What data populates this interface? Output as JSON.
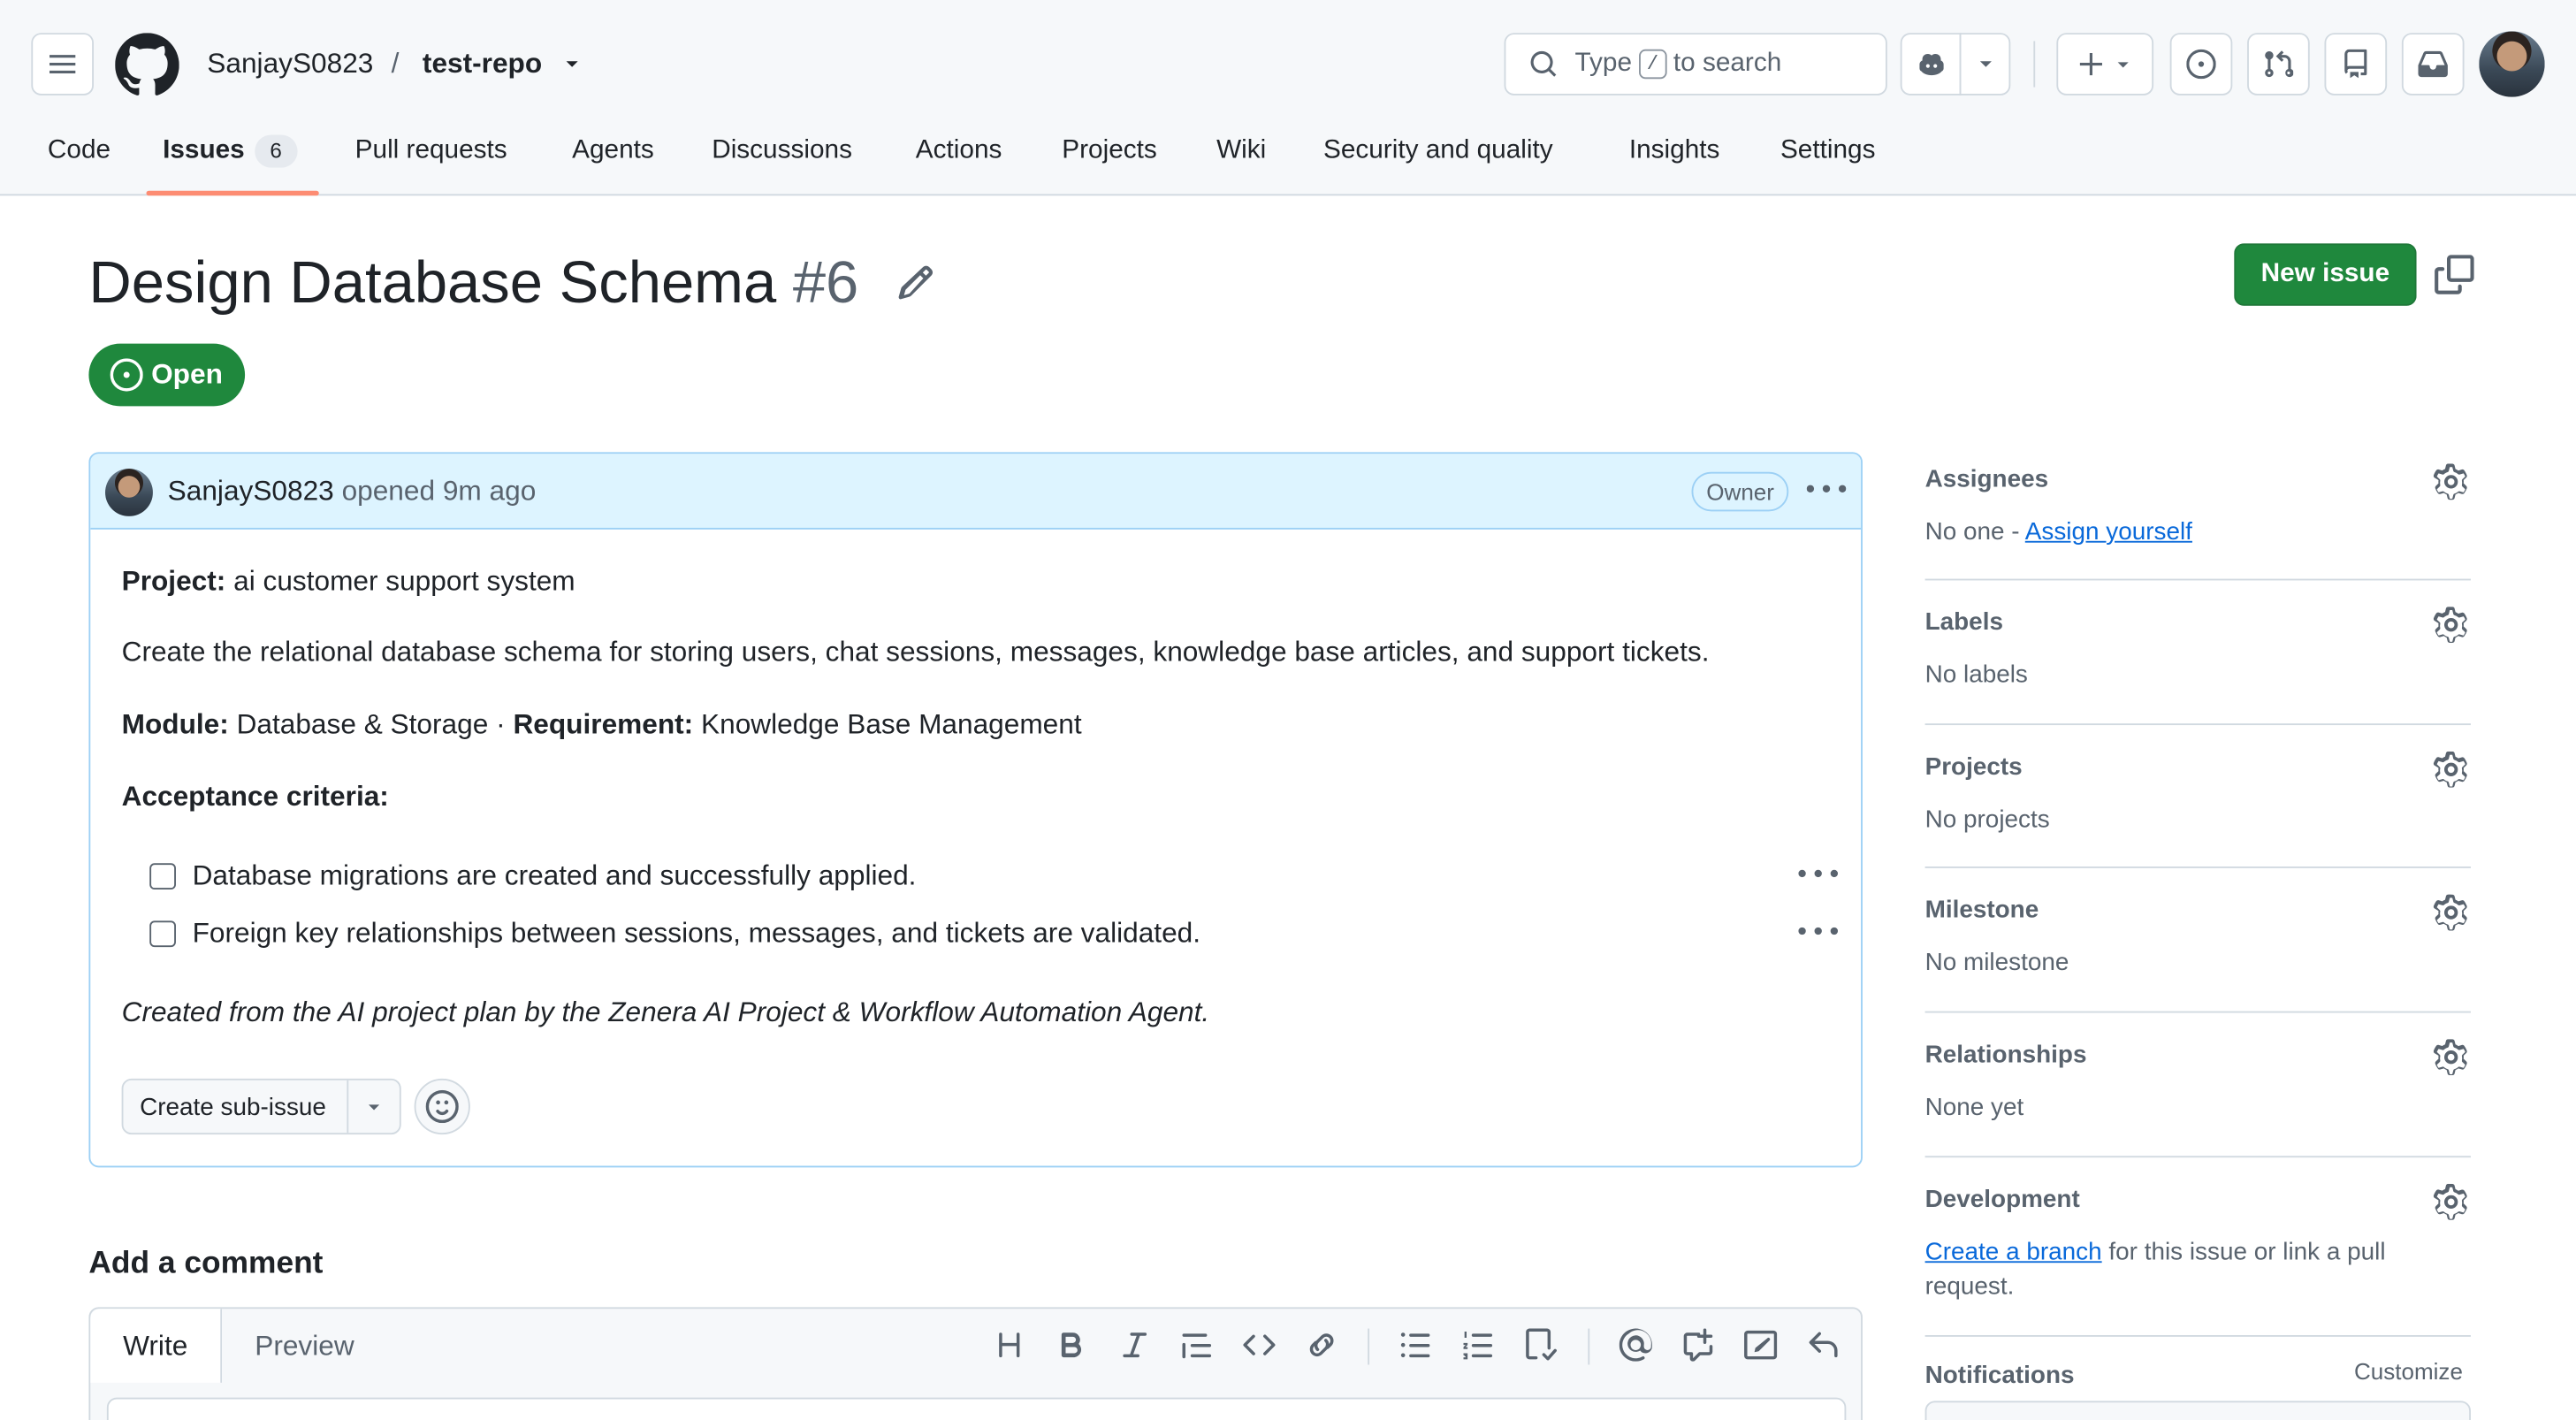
{
  "header": {
    "owner": "SanjayS0823",
    "separator": "/",
    "repo": "test-repo",
    "search_prefix": "Type",
    "search_key": "/",
    "search_suffix": "to search"
  },
  "tabs": [
    {
      "label": "Code"
    },
    {
      "label": "Issues",
      "count": "6"
    },
    {
      "label": "Pull requests"
    },
    {
      "label": "Agents"
    },
    {
      "label": "Discussions"
    },
    {
      "label": "Actions"
    },
    {
      "label": "Projects"
    },
    {
      "label": "Wiki"
    },
    {
      "label": "Security and quality"
    },
    {
      "label": "Insights"
    },
    {
      "label": "Settings"
    }
  ],
  "issue": {
    "title": "Design Database Schema",
    "number": "#6",
    "state": "Open",
    "new_issue_label": "New issue"
  },
  "comment": {
    "author": "SanjayS0823",
    "meta": "opened 9m ago",
    "role_badge": "Owner",
    "project_label": "Project:",
    "project_value": "ai customer support system",
    "description": "Create the relational database schema for storing users, chat sessions, messages, knowledge base articles, and support tickets.",
    "module_label": "Module:",
    "module_value": "Database & Storage",
    "dot": "·",
    "requirement_label": "Requirement:",
    "requirement_value": "Knowledge Base Management",
    "criteria_heading": "Acceptance criteria:",
    "criteria": [
      "Database migrations are created and successfully applied.",
      "Foreign key relationships between sessions, messages, and tickets are validated."
    ],
    "footer_note": "Created from the AI project plan by the Zenera AI Project & Workflow Automation Agent.",
    "sub_issue_label": "Create sub-issue"
  },
  "add_comment": {
    "heading": "Add a comment",
    "write_tab": "Write",
    "preview_tab": "Preview"
  },
  "sidebar": {
    "assignees": {
      "heading": "Assignees",
      "value_prefix": "No one - ",
      "link": "Assign yourself"
    },
    "labels": {
      "heading": "Labels",
      "value": "No labels"
    },
    "projects": {
      "heading": "Projects",
      "value": "No projects"
    },
    "milestone": {
      "heading": "Milestone",
      "value": "No milestone"
    },
    "relationships": {
      "heading": "Relationships",
      "value": "None yet"
    },
    "development": {
      "heading": "Development",
      "link": "Create a branch",
      "line1_suffix": " for this issue or link a pull",
      "line2": "request."
    },
    "notifications": {
      "heading": "Notifications",
      "customize": "Customize"
    }
  },
  "colors": {
    "accent_green": "#1f883d",
    "link_blue": "#0969da",
    "tab_underline": "#fd8c73",
    "comment_header_bg": "#ddf4ff"
  }
}
